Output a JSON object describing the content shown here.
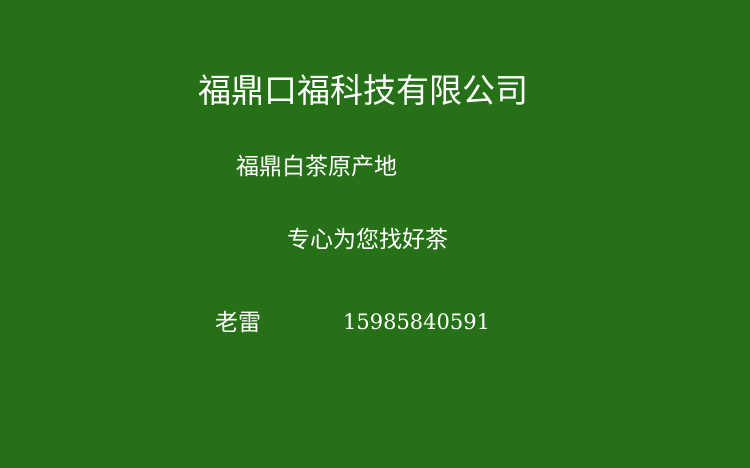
{
  "card": {
    "background_color": "#267017",
    "text_color": "#ffffff",
    "company_name": "福鼎口福科技有限公司",
    "origin_text": "福鼎白茶原产地",
    "slogan": "专心为您找好茶",
    "contact": {
      "name": "老雷",
      "phone": "15985840591"
    }
  }
}
